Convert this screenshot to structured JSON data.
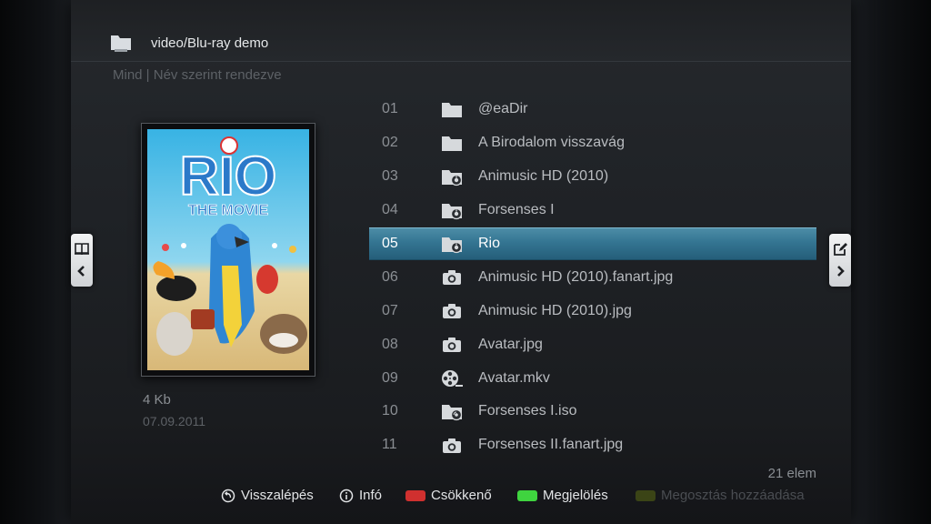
{
  "header": {
    "title": "video/Blu-ray demo",
    "icon": "folder-icon"
  },
  "filter": {
    "text": "Mind | Név szerint rendezve"
  },
  "preview": {
    "size": "4 Kb",
    "date": "07.09.2011",
    "poster_title": "RIO",
    "poster_subtitle": "THE MOVIE"
  },
  "list": {
    "items": [
      {
        "num": "01",
        "name": "@eaDir",
        "icon": "folder-icon"
      },
      {
        "num": "02",
        "name": "A Birodalom visszavág",
        "icon": "folder-icon"
      },
      {
        "num": "03",
        "name": "Animusic HD (2010)",
        "icon": "video-folder-icon"
      },
      {
        "num": "04",
        "name": "Forsenses I",
        "icon": "video-folder-icon"
      },
      {
        "num": "05",
        "name": "Rio",
        "icon": "video-folder-icon",
        "selected": true
      },
      {
        "num": "06",
        "name": "Animusic HD (2010).fanart.jpg",
        "icon": "camera-icon"
      },
      {
        "num": "07",
        "name": "Animusic HD (2010).jpg",
        "icon": "camera-icon"
      },
      {
        "num": "08",
        "name": "Avatar.jpg",
        "icon": "camera-icon"
      },
      {
        "num": "09",
        "name": "Avatar.mkv",
        "icon": "film-reel-icon"
      },
      {
        "num": "10",
        "name": "Forsenses I.iso",
        "icon": "disc-folder-icon"
      },
      {
        "num": "11",
        "name": "Forsenses II.fanart.jpg",
        "icon": "camera-icon"
      }
    ],
    "count": "21 elem"
  },
  "footer": {
    "back": "Visszalépés",
    "info": "Infó",
    "red": "Csökkenő",
    "green": "Megjelölés",
    "yellow": "Megosztás hozzáadása"
  },
  "colors": {
    "selection": "#347592",
    "red_key": "#d0302f",
    "green_key": "#3fd43f",
    "yellow_key": "#3b4416"
  }
}
